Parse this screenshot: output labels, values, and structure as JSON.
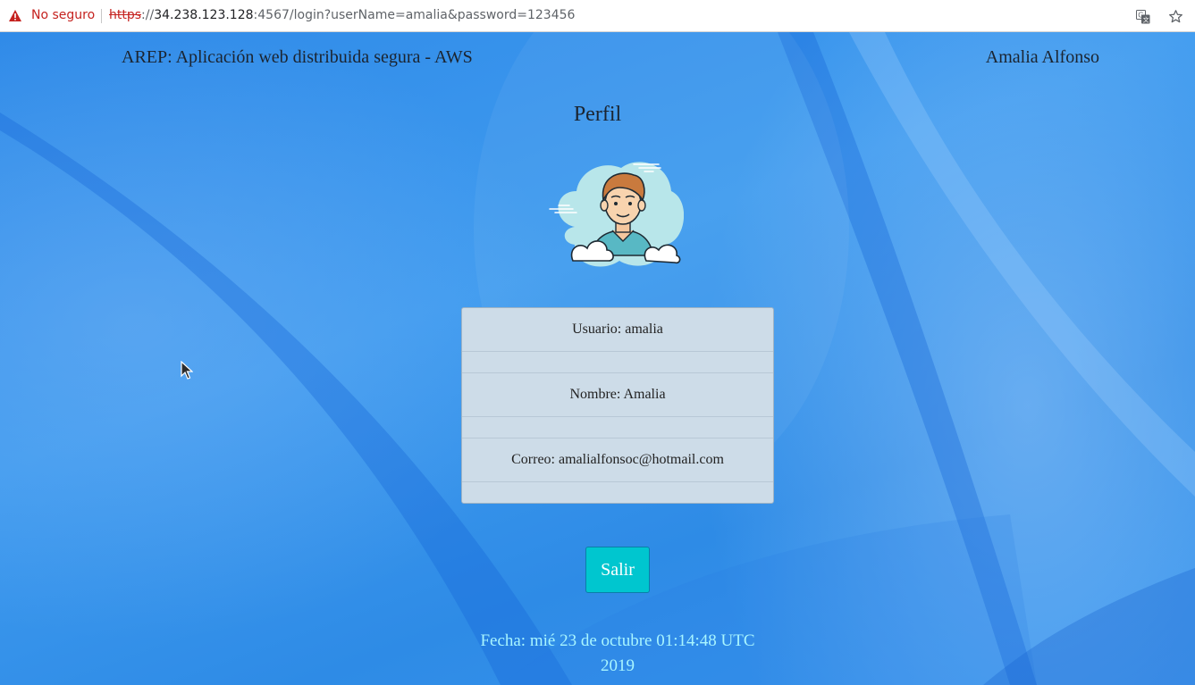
{
  "browser": {
    "security_label": "No seguro",
    "url_scheme": "https",
    "url_sep": "://",
    "url_host": "34.238.123.128",
    "url_rest": ":4567/login?userName=amalia&password=123456"
  },
  "header": {
    "title": "AREP: Aplicación web distribuida segura - AWS",
    "user_name": "Amalia Alfonso"
  },
  "profile": {
    "title": "Perfil",
    "username_line": "Usuario: amalia",
    "name_line": "Nombre: Amalia",
    "email_line": "Correo: amalialfonsoc@hotmail.com"
  },
  "actions": {
    "logout_label": "Salir"
  },
  "footer": {
    "date_line": "Fecha: mié 23 de octubre 01:14:48 UTC 2019"
  },
  "icons": {
    "warning": "warning-triangle-icon",
    "translate": "translate-icon",
    "bookmark": "star-icon",
    "avatar": "user-avatar-icon",
    "cursor": "mouse-cursor-icon"
  },
  "colors": {
    "page_background": "#3a98ee",
    "card_background": "#cddce8",
    "button_background": "#00c6cf",
    "date_text": "#a8f5ff",
    "warning_red": "#c5221f"
  }
}
